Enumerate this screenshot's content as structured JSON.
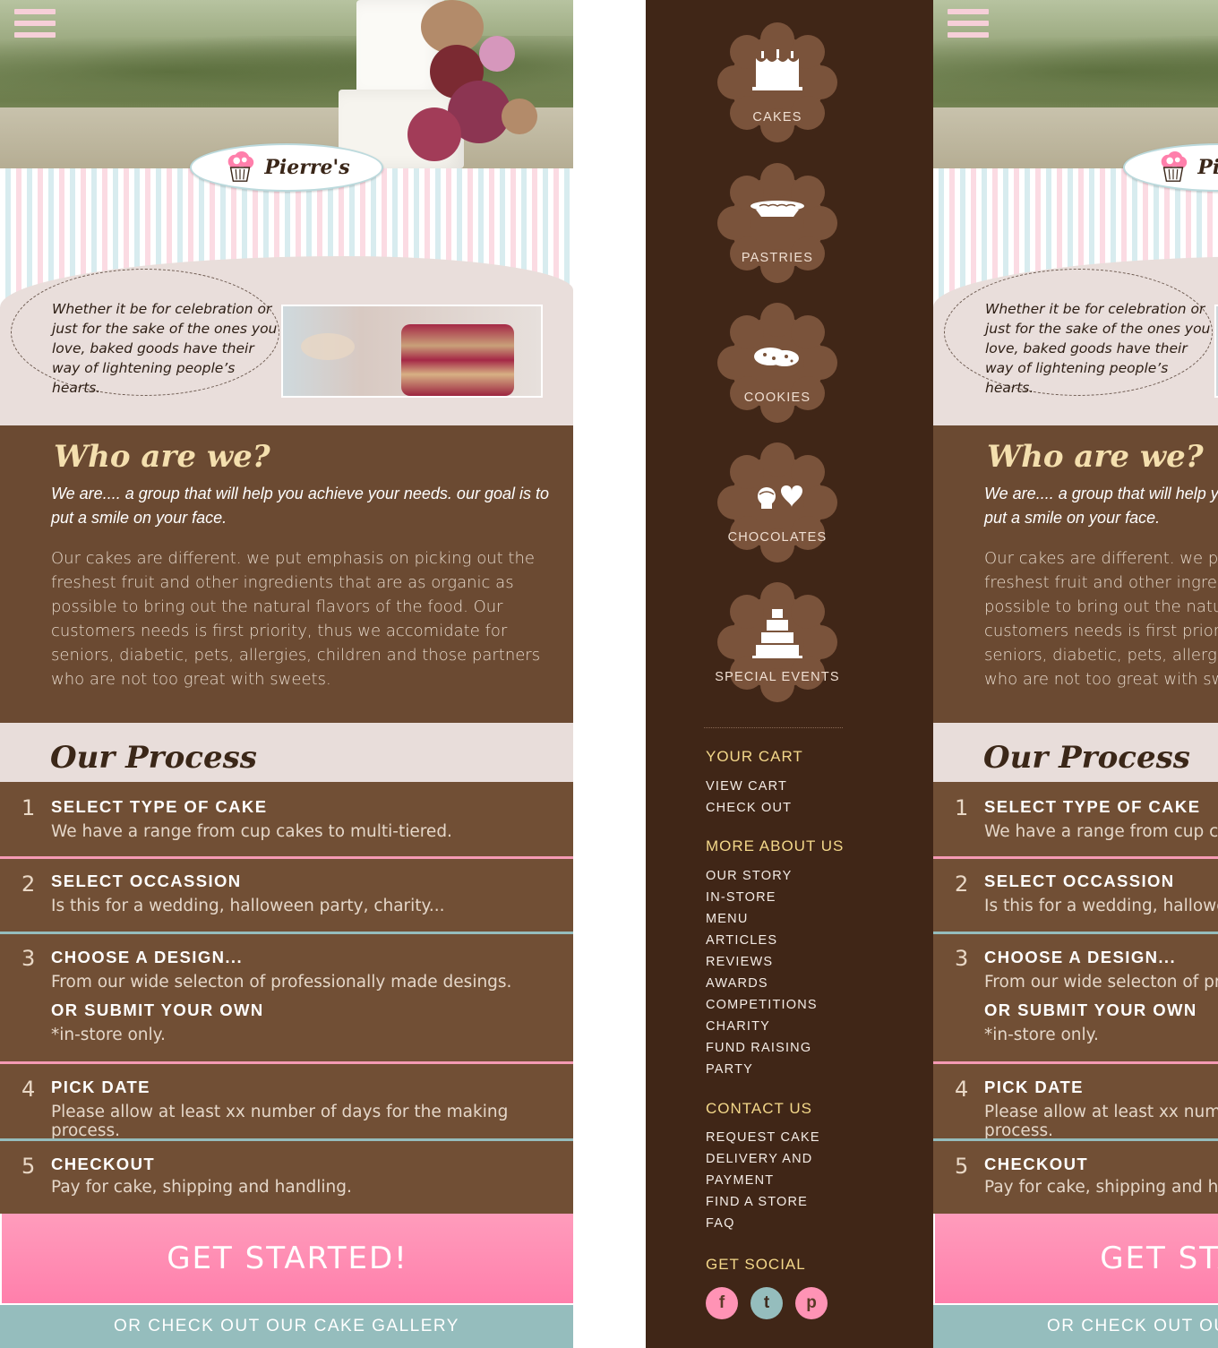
{
  "menu_icon": "hamburger-icon",
  "brand": {
    "name": "Pierre's",
    "logo_icon": "chef-cupcake-icon"
  },
  "intro": {
    "quote": "Whether it be for celebration or just for the sake of the ones you love, baked goods have their way of lightening people’s hearts."
  },
  "who": {
    "title": "Who are we?",
    "lead": "We are.... a group that will help you achieve your needs. our goal is to put a smile on your face.",
    "body": "Our cakes are different. we put emphasis on picking out the freshest fruit and other ingredients that are as organic as possible to bring out the natural flavors of the food. Our customers needs is first priority, thus we accomidate for seniors, diabetic, pets, allergies, children and those partners who are not too great with sweets."
  },
  "process": {
    "title": "Our Process",
    "steps": [
      {
        "num": "1",
        "title": "SELECT TYPE OF CAKE",
        "desc": "We have a range from cup cakes to multi-tiered."
      },
      {
        "num": "2",
        "title": "SELECT OCCASSION",
        "desc": "Is this for a wedding, halloween party, charity..."
      },
      {
        "num": "3",
        "title": "CHOOSE A DESIGN...",
        "desc": "From our wide selecton of professionally made desings.",
        "title2": "OR SUBMIT YOUR OWN",
        "note": "*in-store only."
      },
      {
        "num": "4",
        "title": "PICK DATE",
        "desc": "Please allow at least xx number of days for the making process."
      },
      {
        "num": "5",
        "title": "CHECKOUT",
        "desc": "Pay for cake, shipping and handling."
      }
    ]
  },
  "cta": {
    "label": "GET STARTED!"
  },
  "gallery": {
    "label": "OR CHECK OUT OUR CAKE GALLERY"
  },
  "drawer": {
    "categories": [
      {
        "label": "CAKES",
        "icon": "cake-icon"
      },
      {
        "label": "PASTRIES",
        "icon": "pie-icon"
      },
      {
        "label": "COOKIES",
        "icon": "cookies-icon"
      },
      {
        "label": "CHOCOLATES",
        "icon": "chocolates-icon"
      },
      {
        "label": "SPECIAL EVENTS",
        "icon": "tiered-cake-icon"
      }
    ],
    "cart": {
      "heading": "YOUR CART",
      "links": [
        "VIEW CART",
        "CHECK OUT"
      ]
    },
    "about": {
      "heading": "MORE ABOUT US",
      "links": [
        "OUR STORY",
        "IN-STORE",
        "MENU",
        "ARTICLES",
        "REVIEWS",
        "AWARDS",
        "COMPETITIONS",
        "CHARITY",
        "FUND RAISING",
        "PARTY"
      ]
    },
    "contact": {
      "heading": "CONTACT US",
      "links": [
        "REQUEST CAKE",
        "DELIVERY AND",
        "PAYMENT",
        "FIND A STORE",
        "FAQ"
      ]
    },
    "social": {
      "heading": "GET SOCIAL",
      "icons": [
        "facebook-icon",
        "tumblr-icon",
        "pinterest-icon"
      ],
      "glyphs": [
        "f",
        "t",
        "p"
      ]
    }
  },
  "colors": {
    "brown": "#714f35",
    "dark_brown": "#402617",
    "pink": "#ff8fb5",
    "teal": "#95bdbd",
    "gold": "#f4d88a"
  }
}
